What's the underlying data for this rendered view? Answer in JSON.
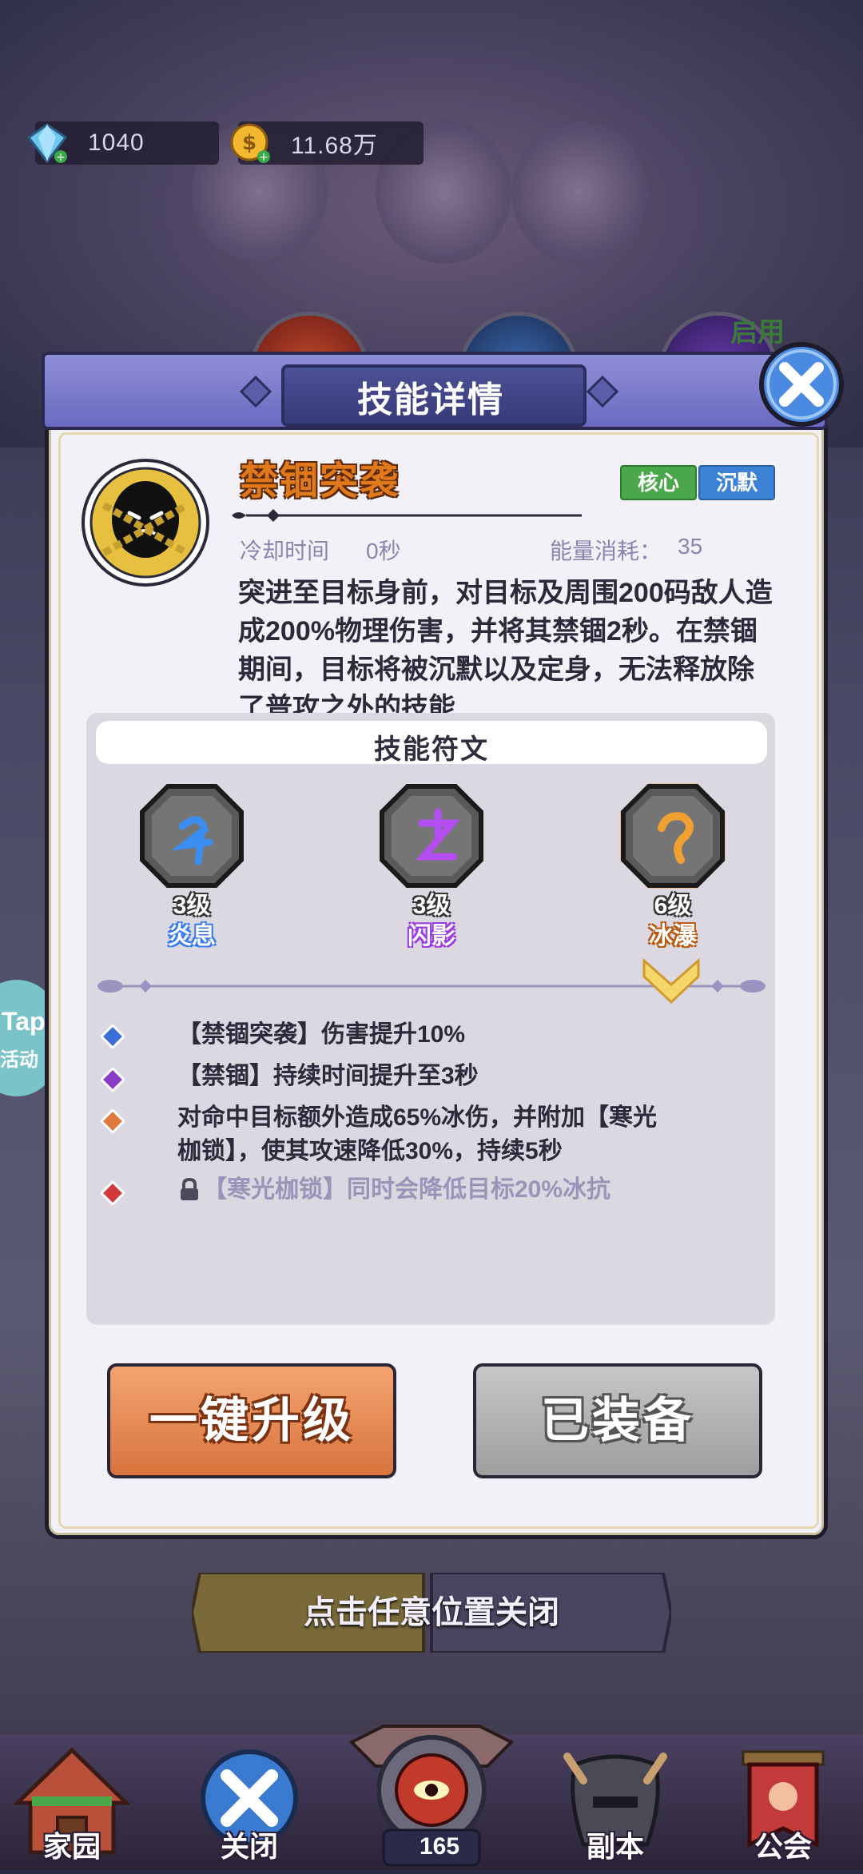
{
  "resources": {
    "gems": "1040",
    "gold": "11.68万"
  },
  "background": {
    "enable_label": "启用",
    "tap_label": "Tap",
    "tap_sub": "活动",
    "hint": "点击任意位置关闭"
  },
  "dialog": {
    "title": "技能详情",
    "skill": {
      "name": "禁锢突袭",
      "tags": [
        "核心",
        "沉默"
      ],
      "cooldown_label": "冷却时间",
      "cooldown_value": "0秒",
      "energy_label": "能量消耗：",
      "energy_value": "35",
      "description": "突进至目标身前，对目标及周围200码敌人造成200%物理伤害，并将其禁锢2秒。在禁锢期间，目标将被沉默以及定身，无法释放除了普攻之外的技能"
    },
    "runes": {
      "title": "技能符文",
      "items": [
        {
          "level": "3级",
          "name": "炎息",
          "color": "#3b7be8"
        },
        {
          "level": "3级",
          "name": "闪影",
          "color": "#9a3be0"
        },
        {
          "level": "6级",
          "name": "冰瀑",
          "color": "#e07a1c"
        }
      ]
    },
    "effects": [
      {
        "text": "【禁锢突袭】伤害提升10%",
        "gem_color": "#3b6fd8"
      },
      {
        "text": "【禁锢】持续时间提升至3秒",
        "gem_color": "#8a3cc8"
      },
      {
        "text_line1": "对命中目标额外造成65%冰伤，并附加【寒光",
        "text_line2": "枷锁】，使其攻速降低30%，持续5秒",
        "gem_color": "#e07a3c"
      },
      {
        "text": "【寒光枷锁】同时会降低目标20%冰抗",
        "gem_color": "#d03a3a",
        "locked": true
      }
    ],
    "buttons": {
      "upgrade": "一键升级",
      "equipped": "已装备"
    }
  },
  "nav": {
    "home": "家园",
    "close": "关闭",
    "level": "165",
    "dungeon": "副本",
    "guild": "公会"
  }
}
